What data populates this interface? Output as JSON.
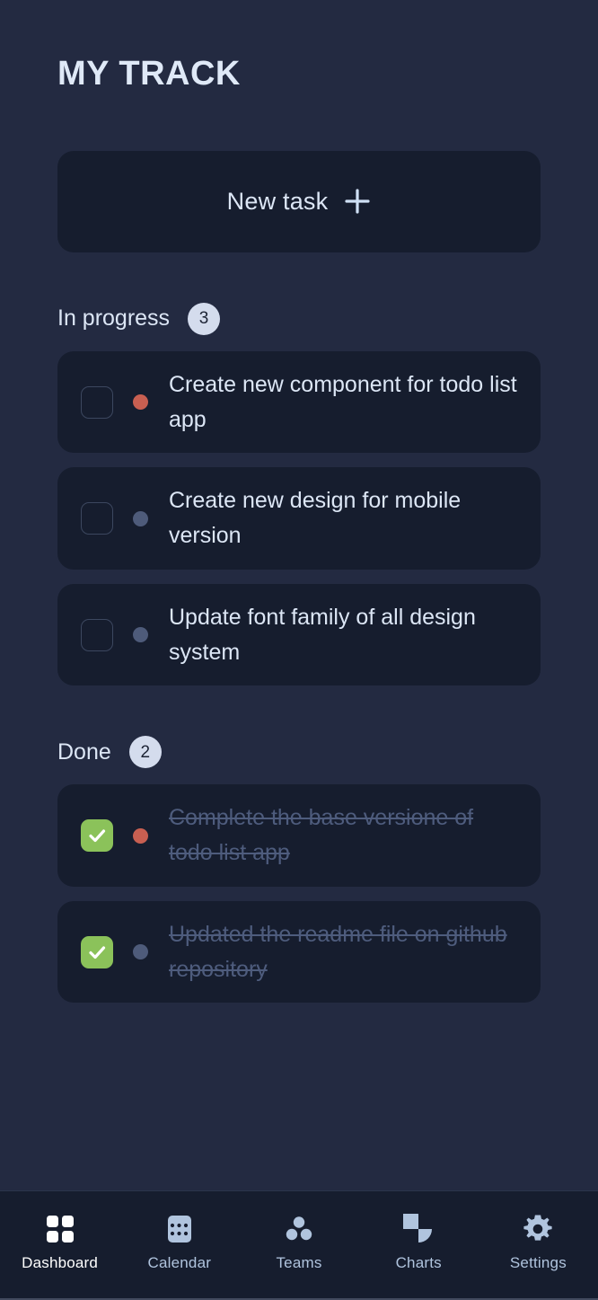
{
  "header": {
    "title": "MY TRACK"
  },
  "new_task": {
    "label": "New task",
    "icon": "plus-icon"
  },
  "sections": [
    {
      "id": "in-progress",
      "title": "In progress",
      "count": "3",
      "tasks": [
        {
          "text": "Create new component for todo list app",
          "done": false,
          "dot_color": "#c85f51"
        },
        {
          "text": "Create new design for mobile version",
          "done": false,
          "dot_color": "#4e5b7a"
        },
        {
          "text": "Update font family of all design system",
          "done": false,
          "dot_color": "#4e5b7a"
        }
      ]
    },
    {
      "id": "done",
      "title": "Done",
      "count": "2",
      "tasks": [
        {
          "text": "Complete the base versione of todo list app",
          "done": true,
          "dot_color": "#c85f51"
        },
        {
          "text": "Updated the readme file on github repository",
          "done": true,
          "dot_color": "#4e5b7a"
        }
      ]
    }
  ],
  "bottom_nav": {
    "items": [
      {
        "label": "Dashboard",
        "icon": "grid-icon",
        "active": true
      },
      {
        "label": "Calendar",
        "icon": "calendar-icon",
        "active": false
      },
      {
        "label": "Teams",
        "icon": "people-icon",
        "active": false
      },
      {
        "label": "Charts",
        "icon": "pie-chart-icon",
        "active": false
      },
      {
        "label": "Settings",
        "icon": "gear-icon",
        "active": false
      }
    ]
  },
  "colors": {
    "page_background": "#232a41",
    "card_background": "#161d2e",
    "text_primary": "#dce6f5",
    "text_done": "#4e5c7d",
    "badge_background": "#d4dced",
    "badge_text": "#1c2334",
    "checkbox_checked": "#8bc25a",
    "nav_active": "#ffffff",
    "nav_inactive": "#b0c4de"
  }
}
